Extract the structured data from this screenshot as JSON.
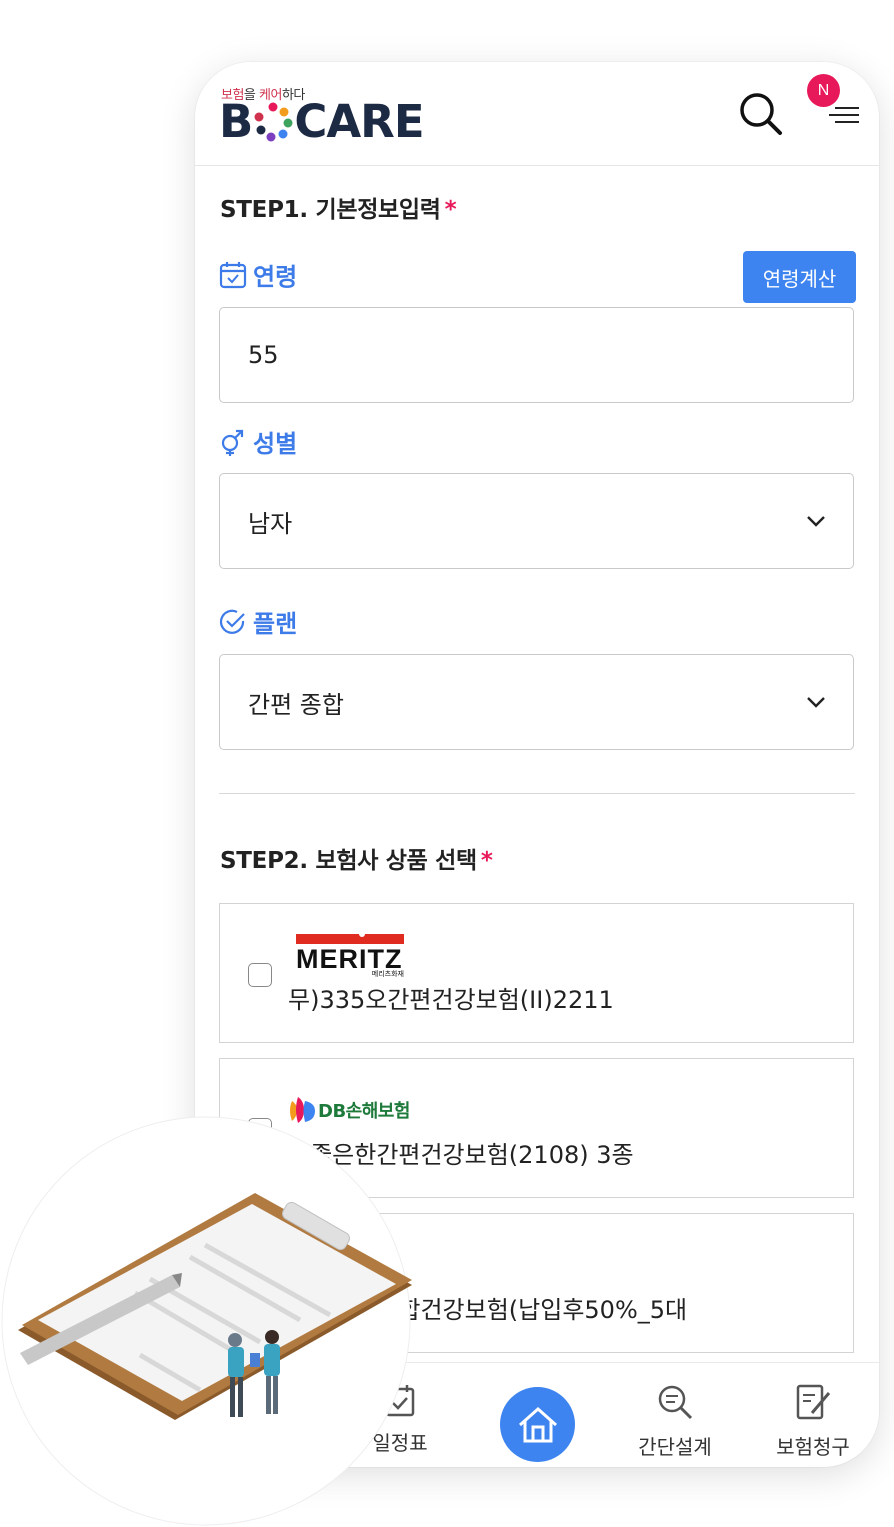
{
  "header": {
    "logo_tag_red1": "보험",
    "logo_tag_dark1": "을 ",
    "logo_tag_red2": "케어",
    "logo_tag_dark2": "하다",
    "logo_B": "B",
    "logo_rest": "CARE",
    "notification_badge": "N",
    "search_icon": "search-icon",
    "menu_icon": "hamburger-menu-icon"
  },
  "step1": {
    "title": "STEP1. 기본정보입력",
    "required_mark": "*",
    "age": {
      "label": "연령",
      "icon": "calendar-icon",
      "calc_button": "연령계산",
      "value": "55"
    },
    "gender": {
      "label": "성별",
      "icon": "gender-icon",
      "selected": "남자"
    },
    "plan": {
      "label": "플랜",
      "icon": "check-circle-icon",
      "selected": "간편 종합"
    }
  },
  "step2": {
    "title": "STEP2. 보험사 상품 선택",
    "required_mark": "*",
    "products": [
      {
        "insurer_logo_text": "MERITZ",
        "insurer_logo_sub": "메리츠화재",
        "name": "무)335오간편건강보험(II)2211"
      },
      {
        "insurer_logo_text": "DB손해보험",
        "name": "참좋은한간편건강보험(2108) 3종"
      },
      {
        "name": "간편실속종합건강보험(납입후50%_5대"
      }
    ]
  },
  "bottom_nav": {
    "items": [
      {
        "label": "일정표",
        "icon": "calendar-check-icon"
      },
      {
        "label": "",
        "icon": "home-icon"
      },
      {
        "label": "간단설계",
        "icon": "search-doc-icon"
      },
      {
        "label": "보험청구",
        "icon": "edit-doc-icon"
      }
    ]
  },
  "colors": {
    "accent": "#3e84f0",
    "required": "#e8195a",
    "logo_navy": "#1d2a44",
    "meritz_red": "#e02b20",
    "db_green": "#1d7a3a"
  }
}
